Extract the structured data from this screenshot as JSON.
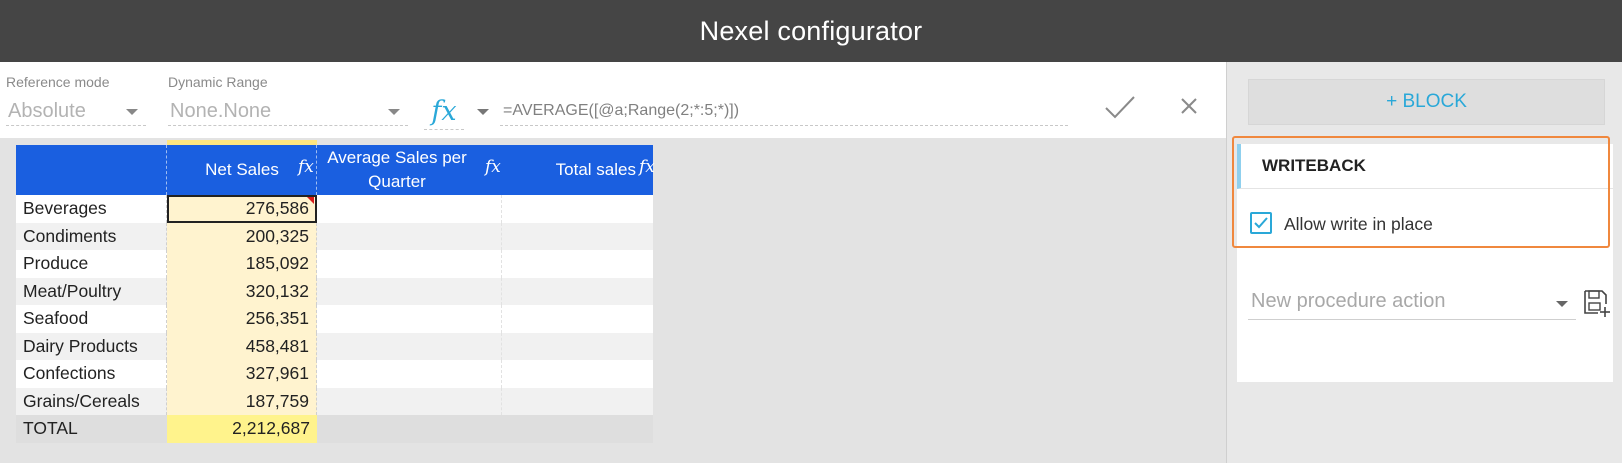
{
  "app": {
    "title": "Nexel configurator"
  },
  "toolbar": {
    "reference_mode": {
      "label": "Reference mode",
      "value": "Absolute"
    },
    "dynamic_range": {
      "label": "Dynamic Range",
      "value": "None.None"
    },
    "fx_label": "fx",
    "formula": "=AVERAGE([@a;Range(2;*:5;*)])",
    "icons": {
      "confirm": "check-icon",
      "cancel": "close-icon",
      "fx_dropdown": "chevron-down-icon"
    }
  },
  "grid": {
    "headers": {
      "label": "",
      "net_sales": "Net Sales",
      "avg_sales_line1": "Average Sales per",
      "avg_sales_line2": "Quarter",
      "total_sales": "Total sales"
    },
    "fx_marker": "fx",
    "rows": [
      {
        "label": "Beverages",
        "net_sales": "276,586"
      },
      {
        "label": "Condiments",
        "net_sales": "200,325"
      },
      {
        "label": "Produce",
        "net_sales": "185,092"
      },
      {
        "label": "Meat/Poultry",
        "net_sales": "320,132"
      },
      {
        "label": "Seafood",
        "net_sales": "256,351"
      },
      {
        "label": "Dairy Products",
        "net_sales": "458,481"
      },
      {
        "label": "Confections",
        "net_sales": "327,961"
      },
      {
        "label": "Grains/Cereals",
        "net_sales": "187,759"
      }
    ],
    "total": {
      "label": "TOTAL",
      "net_sales": "2,212,687"
    },
    "colors": {
      "header": "#1a5fe0",
      "net_column": "#fff3cf",
      "total_net": "#fff38c"
    }
  },
  "sidepanel": {
    "add_block_label": "+ BLOCK",
    "writeback": {
      "title": "WRITEBACK",
      "allow_write_label": "Allow write in place",
      "allow_write_checked": true
    },
    "procedure": {
      "placeholder": "New procedure action",
      "save_icon": "save-add-icon"
    },
    "colors": {
      "accent": "#2aa8d8",
      "highlight_frame": "#f0883e"
    }
  }
}
